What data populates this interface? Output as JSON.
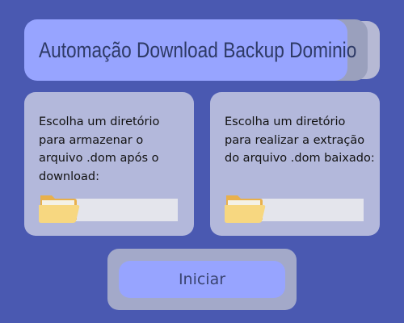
{
  "header": {
    "title": "Automação Download Backup Dominio"
  },
  "panels": {
    "download": {
      "instruction": "Escolha um diretório para armazenar o arquivo .dom após o download:",
      "icon": "folder-icon"
    },
    "extract": {
      "instruction": "Escolha um diretório para realizar a extração do arquivo .dom baixado:",
      "icon": "folder-icon"
    }
  },
  "actions": {
    "start_label": "Iniciar"
  },
  "colors": {
    "background": "#4a59b1",
    "accent": "#97a4ff",
    "panel": "#b3b8db",
    "folder": "#f5d27a"
  }
}
